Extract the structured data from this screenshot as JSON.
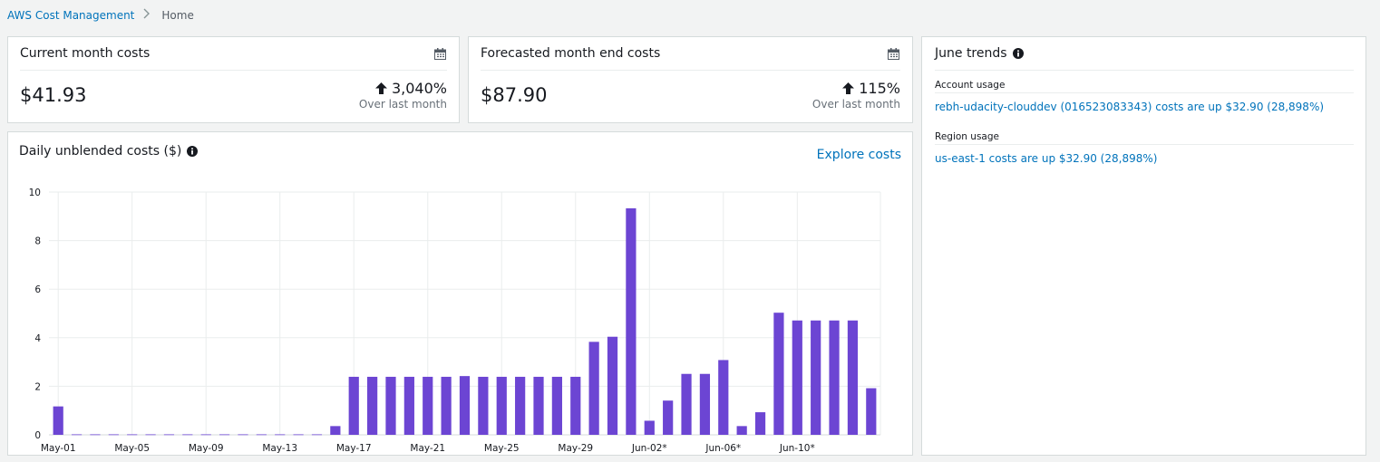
{
  "breadcrumb": {
    "root": "AWS Cost Management",
    "current": "Home"
  },
  "current_month": {
    "title": "Current month costs",
    "value": "$41.93",
    "change": "3,040%",
    "change_label": "Over last month",
    "calendar_icon": "calendar-icon",
    "trend_icon": "arrow-up-icon"
  },
  "forecast": {
    "title": "Forecasted month end costs",
    "value": "$87.90",
    "change": "115%",
    "change_label": "Over last month",
    "calendar_icon": "calendar-icon",
    "trend_icon": "arrow-up-icon"
  },
  "daily_costs": {
    "title": "Daily unblended costs ($)",
    "info_icon": "info-icon",
    "explore_label": "Explore costs"
  },
  "trends": {
    "title": "June trends",
    "info_icon": "info-icon",
    "account_label": "Account usage",
    "account_text": "rebh-udacity-clouddev (016523083343) costs are up $32.90 (28,898%)",
    "region_label": "Region usage",
    "region_text": "us-east-1 costs are up $32.90 (28,898%)"
  },
  "colors": {
    "bar": "#6c45d3",
    "link": "#0073bb",
    "grid": "#eaeded"
  },
  "chart_data": {
    "type": "bar",
    "title": "Daily unblended costs ($)",
    "xlabel": "",
    "ylabel": "",
    "ylim": [
      0,
      10
    ],
    "yticks": [
      0,
      2,
      4,
      6,
      8,
      10
    ],
    "grid": true,
    "x_tick_labels": [
      "May-01",
      "May-05",
      "May-09",
      "May-13",
      "May-17",
      "May-21",
      "May-25",
      "May-29",
      "Jun-02*",
      "Jun-06*",
      "Jun-10*"
    ],
    "categories": [
      "May-01",
      "May-02",
      "May-03",
      "May-04",
      "May-05",
      "May-06",
      "May-07",
      "May-08",
      "May-09",
      "May-10",
      "May-11",
      "May-12",
      "May-13",
      "May-14",
      "May-15",
      "May-16",
      "May-17",
      "May-18",
      "May-19",
      "May-20",
      "May-21",
      "May-22",
      "May-23",
      "May-24",
      "May-25",
      "May-26",
      "May-27",
      "May-28",
      "May-29",
      "May-30",
      "May-31",
      "Jun-01*",
      "Jun-02*",
      "Jun-03*",
      "Jun-04*",
      "Jun-05*",
      "Jun-06*",
      "Jun-07*",
      "Jun-08*",
      "Jun-09*",
      "Jun-10*",
      "Jun-11*",
      "Jun-12*",
      "Jun-13*",
      "Jun-14*"
    ],
    "values": [
      1.17,
      0.02,
      0.02,
      0.02,
      0.02,
      0.02,
      0.02,
      0.02,
      0.02,
      0.02,
      0.02,
      0.02,
      0.02,
      0.02,
      0.02,
      0.36,
      2.39,
      2.39,
      2.39,
      2.39,
      2.39,
      2.39,
      2.42,
      2.39,
      2.39,
      2.39,
      2.39,
      2.39,
      2.39,
      3.83,
      4.04,
      9.33,
      0.58,
      1.41,
      2.51,
      2.51,
      3.08,
      0.36,
      0.93,
      5.03,
      4.71,
      4.71,
      4.71,
      4.71,
      1.92
    ]
  }
}
